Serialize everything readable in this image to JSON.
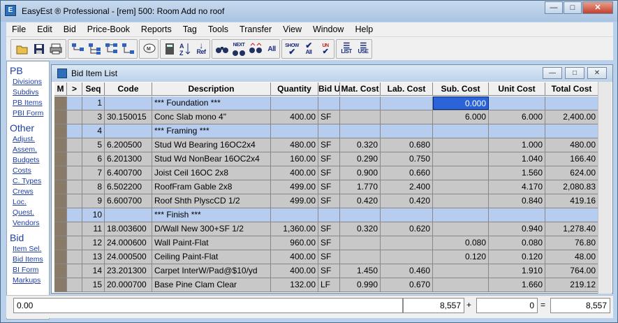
{
  "app": {
    "title": "EasyEst ® Professional - [rem] 500: Room Add no roof",
    "icon_name": "app-icon",
    "window_buttons": [
      "minimize-icon",
      "maximize-icon",
      "close-icon"
    ]
  },
  "menu": [
    "File",
    "Edit",
    "Bid",
    "Price-Book",
    "Reports",
    "Tag",
    "Tools",
    "Transfer",
    "View",
    "Window",
    "Help"
  ],
  "toolbar": {
    "icons": [
      "open-folder-icon",
      "save-icon",
      "print-icon",
      "tree-expand-icon",
      "tree-level-icon",
      "tree-branch-icon",
      "tree-collapse-icon",
      "dialog-icon",
      "calculator-icon",
      "sort-az-icon",
      "ref-icon",
      "binoculars-icon",
      "find-next-icon",
      "find-previous-icon",
      "find-all-icon",
      "show-all-icon",
      "check-all-icon",
      "uncheck-all-icon",
      "list-icon",
      "use-icon"
    ],
    "labels": {
      "ref": "Ref",
      "next": "NEXT",
      "all": "All",
      "show": "SHOW",
      "un": "UN",
      "list": "LIST",
      "use": "USE"
    }
  },
  "sidebar": {
    "sections": [
      {
        "title": "PB",
        "items": [
          "Divisions",
          "Subdivs",
          "PB Items",
          "PBI Form"
        ]
      },
      {
        "title": "Other",
        "items": [
          "Adjust.",
          "Assem.",
          "Budgets",
          "Costs",
          "C. Types",
          "Crews",
          "Loc.",
          "Quest.",
          "Vendors"
        ]
      },
      {
        "title": "Bid",
        "items": [
          "Item Sel.",
          "Bid Items",
          "BI Form",
          "Markups"
        ]
      }
    ]
  },
  "child_window": {
    "title": "Bid Item List"
  },
  "table": {
    "columns": [
      "M",
      ">",
      "Seq",
      "Code",
      "Description",
      "Quantity",
      "Bid U",
      "Mat. Cost",
      "Lab. Cost",
      "Sub. Cost",
      "Unit Cost",
      "Total Cost"
    ],
    "rows": [
      {
        "type": "blue",
        "m": "",
        "arrow": "",
        "seq": "1",
        "code": "",
        "desc": "*** Foundation ***",
        "qty": "",
        "unit": "",
        "mat": "",
        "lab": "",
        "sub": "0.000",
        "unitc": "",
        "total": "",
        "selected": "sub"
      },
      {
        "type": "gray",
        "m": "",
        "arrow": "",
        "seq": "3",
        "code": "30.150015",
        "desc": "Conc Slab mono 4\"",
        "qty": "400.00",
        "unit": "SF",
        "mat": "",
        "lab": "",
        "sub": "6.000",
        "unitc": "6.000",
        "total": "2,400.00"
      },
      {
        "type": "blue",
        "m": "",
        "arrow": "",
        "seq": "4",
        "code": "",
        "desc": "*** Framing ***",
        "qty": "",
        "unit": "",
        "mat": "",
        "lab": "",
        "sub": "",
        "unitc": "",
        "total": ""
      },
      {
        "type": "gray",
        "m": "",
        "arrow": "",
        "seq": "5",
        "code": "6.200500",
        "desc": "Stud Wd Bearing 16OC2x4",
        "qty": "480.00",
        "unit": "SF",
        "mat": "0.320",
        "lab": "0.680",
        "sub": "",
        "unitc": "1.000",
        "total": "480.00"
      },
      {
        "type": "gray",
        "m": "",
        "arrow": "",
        "seq": "6",
        "code": "6.201300",
        "desc": "Stud Wd NonBear 16OC2x4",
        "qty": "160.00",
        "unit": "SF",
        "mat": "0.290",
        "lab": "0.750",
        "sub": "",
        "unitc": "1.040",
        "total": "166.40"
      },
      {
        "type": "gray",
        "m": "",
        "arrow": "",
        "seq": "7",
        "code": "6.400700",
        "desc": "Joist Ceil 16OC 2x8",
        "qty": "400.00",
        "unit": "SF",
        "mat": "0.900",
        "lab": "0.660",
        "sub": "",
        "unitc": "1.560",
        "total": "624.00"
      },
      {
        "type": "gray",
        "m": "",
        "arrow": "",
        "seq": "8",
        "code": "6.502200",
        "desc": "RoofFram Gable 2x8",
        "qty": "499.00",
        "unit": "SF",
        "mat": "1.770",
        "lab": "2.400",
        "sub": "",
        "unitc": "4.170",
        "total": "2,080.83"
      },
      {
        "type": "gray",
        "m": "",
        "arrow": "",
        "seq": "9",
        "code": "6.600700",
        "desc": "Roof Shth PlyscCD 1/2",
        "qty": "499.00",
        "unit": "SF",
        "mat": "0.420",
        "lab": "0.420",
        "sub": "",
        "unitc": "0.840",
        "total": "419.16"
      },
      {
        "type": "blue",
        "m": "",
        "arrow": "",
        "seq": "10",
        "code": "",
        "desc": "*** Finish ***",
        "qty": "",
        "unit": "",
        "mat": "",
        "lab": "",
        "sub": "",
        "unitc": "",
        "total": ""
      },
      {
        "type": "gray",
        "m": "",
        "arrow": "",
        "seq": "11",
        "code": "18.003600",
        "desc": "D/Wall New 300+SF 1/2",
        "qty": "1,360.00",
        "unit": "SF",
        "mat": "0.320",
        "lab": "0.620",
        "sub": "",
        "unitc": "0.940",
        "total": "1,278.40"
      },
      {
        "type": "gray",
        "m": "",
        "arrow": "",
        "seq": "12",
        "code": "24.000600",
        "desc": "Wall Paint-Flat",
        "qty": "960.00",
        "unit": "SF",
        "mat": "",
        "lab": "",
        "sub": "0.080",
        "unitc": "0.080",
        "total": "76.80"
      },
      {
        "type": "gray",
        "m": "",
        "arrow": "",
        "seq": "13",
        "code": "24.000500",
        "desc": "Ceiling Paint-Flat",
        "qty": "400.00",
        "unit": "SF",
        "mat": "",
        "lab": "",
        "sub": "0.120",
        "unitc": "0.120",
        "total": "48.00"
      },
      {
        "type": "gray",
        "m": "",
        "arrow": "",
        "seq": "14",
        "code": "23.201300",
        "desc": "Carpet InterW/Pad@$10/yd",
        "qty": "400.00",
        "unit": "SF",
        "mat": "1.450",
        "lab": "0.460",
        "sub": "",
        "unitc": "1.910",
        "total": "764.00"
      },
      {
        "type": "gray",
        "m": "",
        "arrow": "",
        "seq": "15",
        "code": "20.000700",
        "desc": "Base Pine Clam    Clear",
        "qty": "132.00",
        "unit": "LF",
        "mat": "0.990",
        "lab": "0.670",
        "sub": "",
        "unitc": "1.660",
        "total": "219.12"
      }
    ]
  },
  "statusbar": {
    "left_value": "0.00",
    "subtotal": "8,557",
    "plus": "+",
    "markup": "0",
    "equals": "=",
    "total": "8,557"
  },
  "colors": {
    "header_row": "#b7cdf0",
    "item_row": "#c8c8c8",
    "selected_cell": "#2a64d8",
    "link": "#1f3fa0",
    "title_bar": "#b9d1ea",
    "marker_column": "#8a7a6a"
  }
}
